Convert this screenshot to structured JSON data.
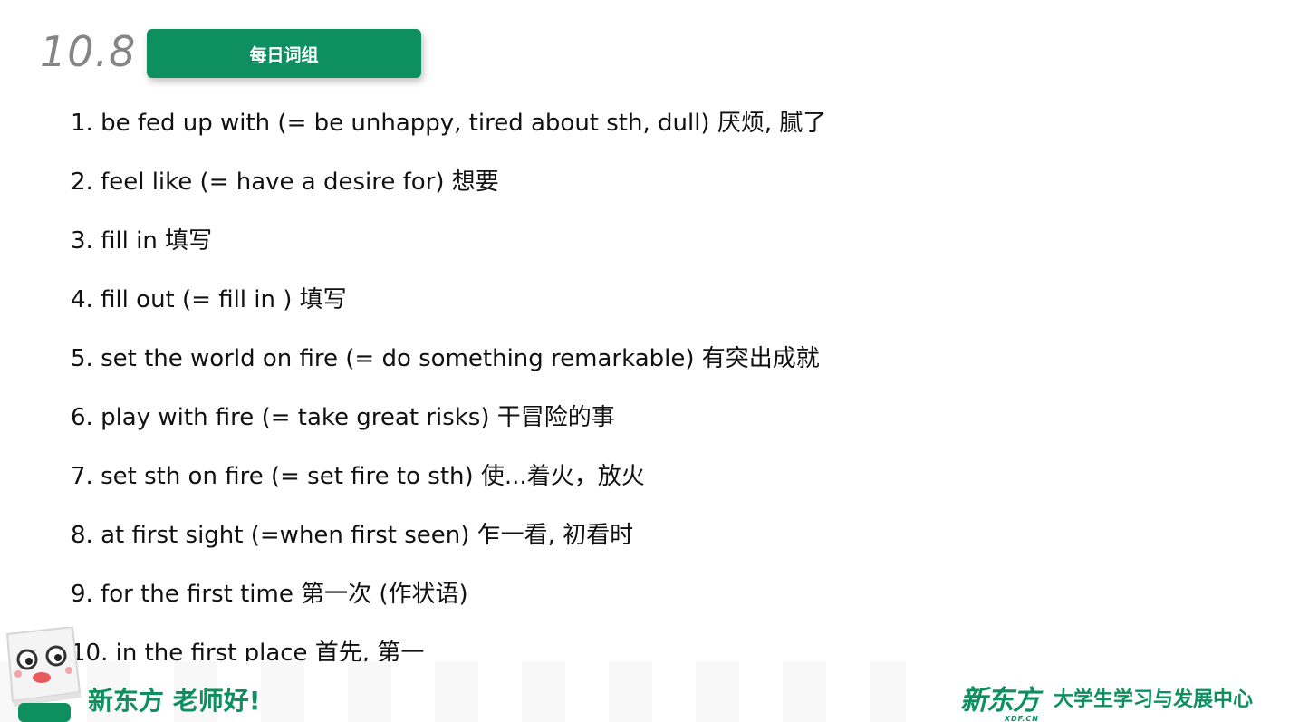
{
  "header": {
    "date": "10.8",
    "badge_label": "每日词组"
  },
  "phrases": [
    "1. be fed up with (= be unhappy, tired about sth, dull) 厌烦, 腻了",
    "2. feel like (= have a desire for) 想要",
    "3. fill in 填写",
    "4. fill out (= fill in ) 填写",
    "5. set the world on fire (= do something remarkable) 有突出成就",
    "6. play with fire (= take great risks) 干冒险的事",
    "7. set sth on fire (= set fire to sth) 使...着火，放火",
    "8. at first sight (=when first seen) 乍一看, 初看时",
    "9. for the first time 第一次 (作状语)",
    "10. in the first place 首先, 第一"
  ],
  "footer": {
    "slogan": "新东方 老师好!",
    "logo_text": "新东方",
    "logo_sub": "XDF.CN",
    "center_name": "大学生学习与发展中心"
  },
  "colors": {
    "brand_green": "#0d8f5f",
    "date_gray": "#858585"
  },
  "icons": {
    "mascot": "book-mascot-icon"
  }
}
